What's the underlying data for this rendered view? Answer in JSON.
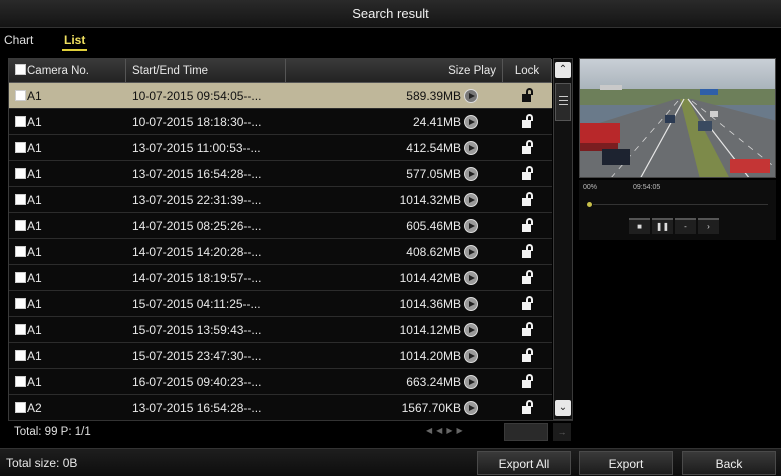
{
  "window": {
    "title": "Search result"
  },
  "tabs": [
    {
      "label": "Chart",
      "active": false
    },
    {
      "label": "List",
      "active": true
    }
  ],
  "table": {
    "headers": {
      "camera": "Camera No.",
      "time": "Start/End Time",
      "size_play": "Size Play",
      "lock": "Lock"
    },
    "rows": [
      {
        "camera": "A1",
        "time": "10-07-2015 09:54:05--...",
        "size": "589.39MB",
        "selected": true
      },
      {
        "camera": "A1",
        "time": "10-07-2015 18:18:30--...",
        "size": "24.41MB",
        "selected": false
      },
      {
        "camera": "A1",
        "time": "13-07-2015 11:00:53--...",
        "size": "412.54MB",
        "selected": false
      },
      {
        "camera": "A1",
        "time": "13-07-2015 16:54:28--...",
        "size": "577.05MB",
        "selected": false
      },
      {
        "camera": "A1",
        "time": "13-07-2015 22:31:39--...",
        "size": "1014.32MB",
        "selected": false
      },
      {
        "camera": "A1",
        "time": "14-07-2015 08:25:26--...",
        "size": "605.46MB",
        "selected": false
      },
      {
        "camera": "A1",
        "time": "14-07-2015 14:20:28--...",
        "size": "408.62MB",
        "selected": false
      },
      {
        "camera": "A1",
        "time": "14-07-2015 18:19:57--...",
        "size": "1014.42MB",
        "selected": false
      },
      {
        "camera": "A1",
        "time": "15-07-2015 04:11:25--...",
        "size": "1014.36MB",
        "selected": false
      },
      {
        "camera": "A1",
        "time": "15-07-2015 13:59:43--...",
        "size": "1014.12MB",
        "selected": false
      },
      {
        "camera": "A1",
        "time": "15-07-2015 23:47:30--...",
        "size": "1014.20MB",
        "selected": false
      },
      {
        "camera": "A1",
        "time": "16-07-2015 09:40:23--...",
        "size": "663.24MB",
        "selected": false
      },
      {
        "camera": "A2",
        "time": "13-07-2015 16:54:28--...",
        "size": "1567.70KB",
        "selected": false
      }
    ]
  },
  "pagination": {
    "summary": "Total: 99  P: 1/1"
  },
  "playback": {
    "zoom_text": "00%",
    "time_text": "09:54:05"
  },
  "icons": {
    "play": "play-circle-icon",
    "lock": "unlock-icon",
    "scroll_up": "chevron-up-icon",
    "scroll_down": "chevron-down-icon"
  },
  "footer": {
    "total_size": "Total size: 0B",
    "export_all": "Export All",
    "export": "Export",
    "back": "Back"
  },
  "colors": {
    "accent": "#e0cf3a",
    "selected_row": "#bfb79a",
    "background": "#000000"
  }
}
